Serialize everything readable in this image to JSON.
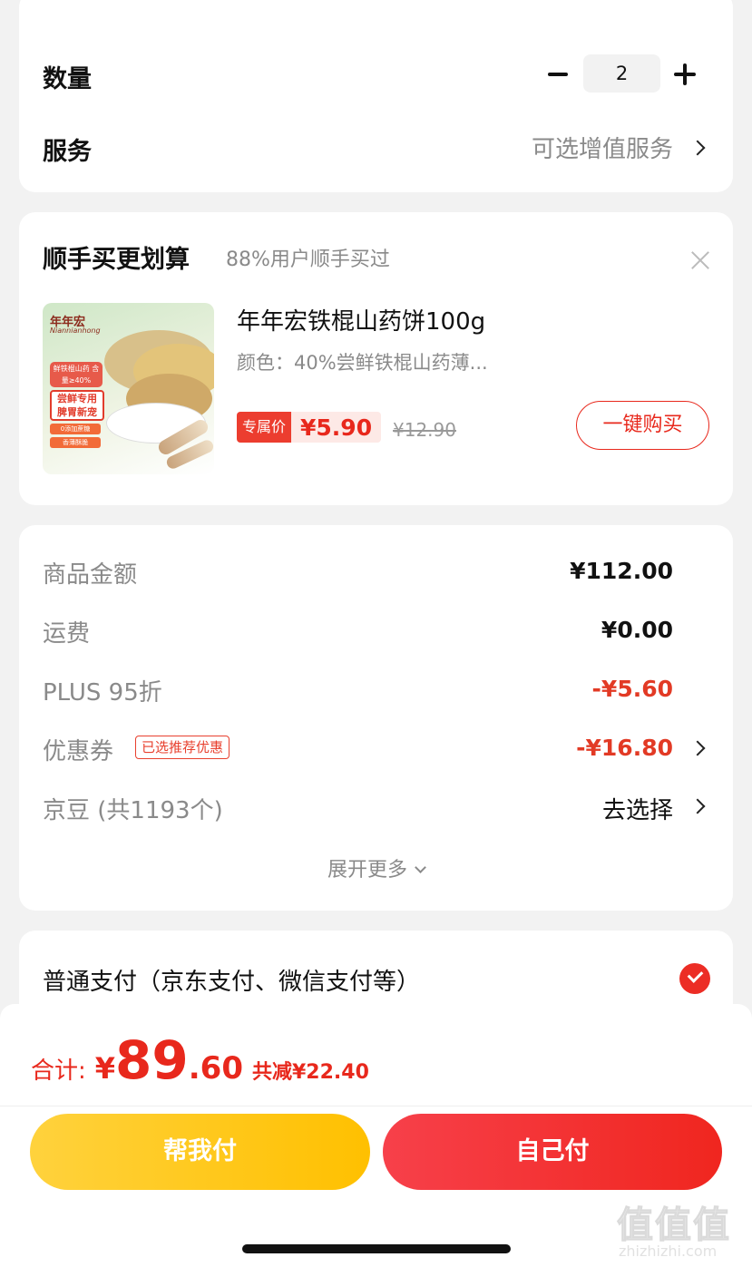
{
  "quantity_card": {
    "quantity_label": "数量",
    "quantity_value": "2",
    "service_label": "服务",
    "service_value": "可选增值服务"
  },
  "addon_card": {
    "title": "顺手买更划算",
    "subtitle": "88%用户顺手买过",
    "product": {
      "name": "年年宏铁棍山药饼100g",
      "spec": "颜色：40%尝鲜铁棍山药薄...",
      "price_label": "专属价",
      "price": "¥5.90",
      "original_price": "¥12.90",
      "buy_button": "一键购买",
      "image_texts": {
        "brand": "年年宏",
        "brand_en": "Niannianhong",
        "tag1": "鲜铁棍山药 含量≥40%",
        "tag2": "尝鲜专用 脾胃新宠",
        "tag3": "0添加蔗糖",
        "tag4": "香薄酥脆"
      }
    }
  },
  "summary_card": {
    "rows": [
      {
        "label": "商品金额",
        "value": "¥112.00"
      },
      {
        "label": "运费",
        "value": "¥0.00"
      },
      {
        "label": "PLUS 95折",
        "value": "-¥5.60"
      },
      {
        "label": "优惠券",
        "badge": "已选推荐优惠",
        "value": "-¥16.80"
      },
      {
        "label": "京豆 (共1193个)",
        "value": "去选择"
      }
    ],
    "expand_label": "展开更多"
  },
  "payment_card": {
    "method": "普通支付（京东支付、微信支付等）"
  },
  "bottom_bar": {
    "total_label": "合计:",
    "currency": "¥",
    "total_integer": "89",
    "total_decimal": ".60",
    "savings": "共减¥22.40",
    "help_pay_button": "帮我付",
    "self_pay_button": "自己付"
  },
  "watermark": {
    "main": "值值值",
    "sub": "zhizhizhi.com"
  },
  "colors": {
    "accent_red": "#e8281c",
    "pay_yellow": "#ffc000",
    "background": "#f2f2f2"
  }
}
